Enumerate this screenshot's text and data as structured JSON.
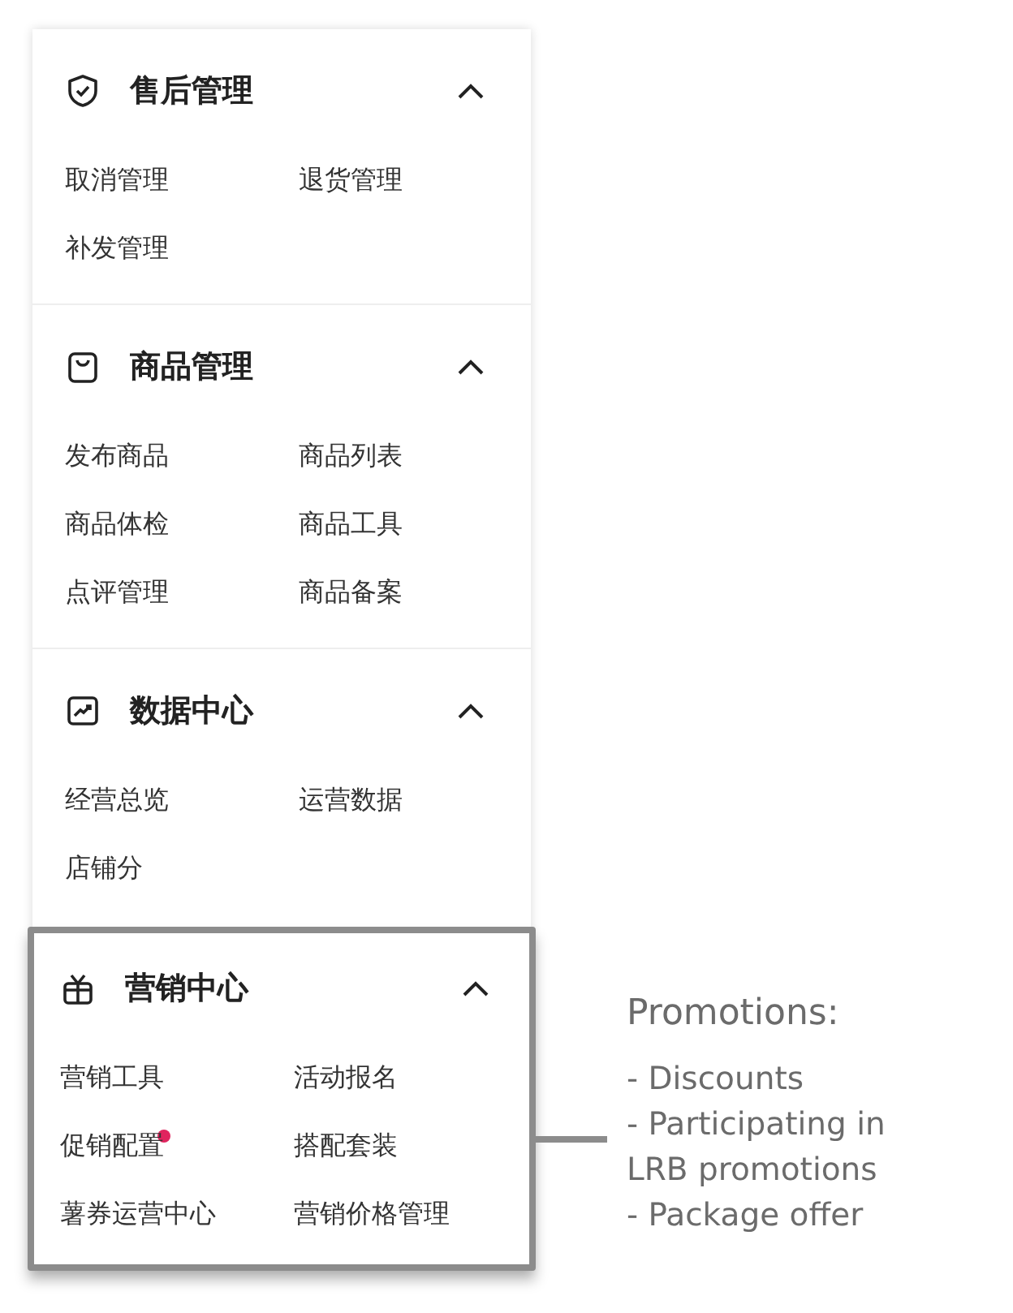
{
  "sections": [
    {
      "title": "售后管理",
      "kind": "shield",
      "expanded": true,
      "highlighted": false,
      "items": [
        {
          "label": "取消管理",
          "badge": false
        },
        {
          "label": "退货管理",
          "badge": false
        },
        {
          "label": "补发管理",
          "badge": false
        }
      ]
    },
    {
      "title": "商品管理",
      "kind": "bag",
      "expanded": true,
      "highlighted": false,
      "items": [
        {
          "label": "发布商品",
          "badge": false
        },
        {
          "label": "商品列表",
          "badge": false
        },
        {
          "label": "商品体检",
          "badge": false
        },
        {
          "label": "商品工具",
          "badge": false
        },
        {
          "label": "点评管理",
          "badge": false
        },
        {
          "label": "商品备案",
          "badge": false
        }
      ]
    },
    {
      "title": "数据中心",
      "kind": "chart",
      "expanded": true,
      "highlighted": false,
      "items": [
        {
          "label": "经营总览",
          "badge": false
        },
        {
          "label": "运营数据",
          "badge": false
        },
        {
          "label": "店铺分",
          "badge": false
        }
      ]
    },
    {
      "title": "营销中心",
      "kind": "gift",
      "expanded": true,
      "highlighted": true,
      "items": [
        {
          "label": "营销工具",
          "badge": false
        },
        {
          "label": "活动报名",
          "badge": false
        },
        {
          "label": "促销配置",
          "badge": true
        },
        {
          "label": "搭配套装",
          "badge": false
        },
        {
          "label": "薯券运营中心",
          "badge": false
        },
        {
          "label": "营销价格管理",
          "badge": false
        }
      ]
    }
  ],
  "callout": {
    "title": "Promotions:",
    "lines": [
      "- Discounts",
      "- Participating in LRB promotions",
      "- Package offer"
    ]
  }
}
